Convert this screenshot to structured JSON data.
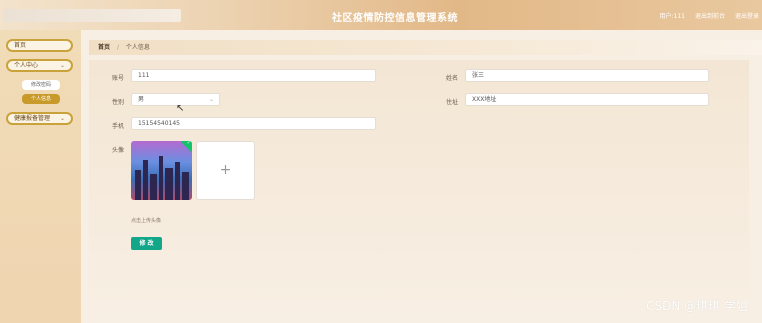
{
  "header": {
    "title": "社区疫情防控信息管理系统",
    "nav": [
      "用户:111",
      "退出到前台",
      "退出登录"
    ]
  },
  "sidebar": {
    "home": "首页",
    "personal_center": "个人中心",
    "change_password": "修改密码",
    "personal_info": "个人信息",
    "health_report": "健康报备管理"
  },
  "breadcrumb": {
    "home": "首页",
    "current": "个人信息"
  },
  "form": {
    "account_label": "账号",
    "account_value": "111",
    "name_label": "姓名",
    "name_value": "张三",
    "gender_label": "性别",
    "gender_value": "男",
    "address_label": "住址",
    "address_value": "XXX地址",
    "phone_label": "手机",
    "phone_value": "15154540145",
    "avatar_label": "头像",
    "upload_hint": "点击上传头像",
    "submit_label": "修 改"
  },
  "icons": {
    "upload": "+",
    "chevron": "⌄",
    "check": "✓"
  },
  "watermark": "CSDN @琪琪 学姐"
}
